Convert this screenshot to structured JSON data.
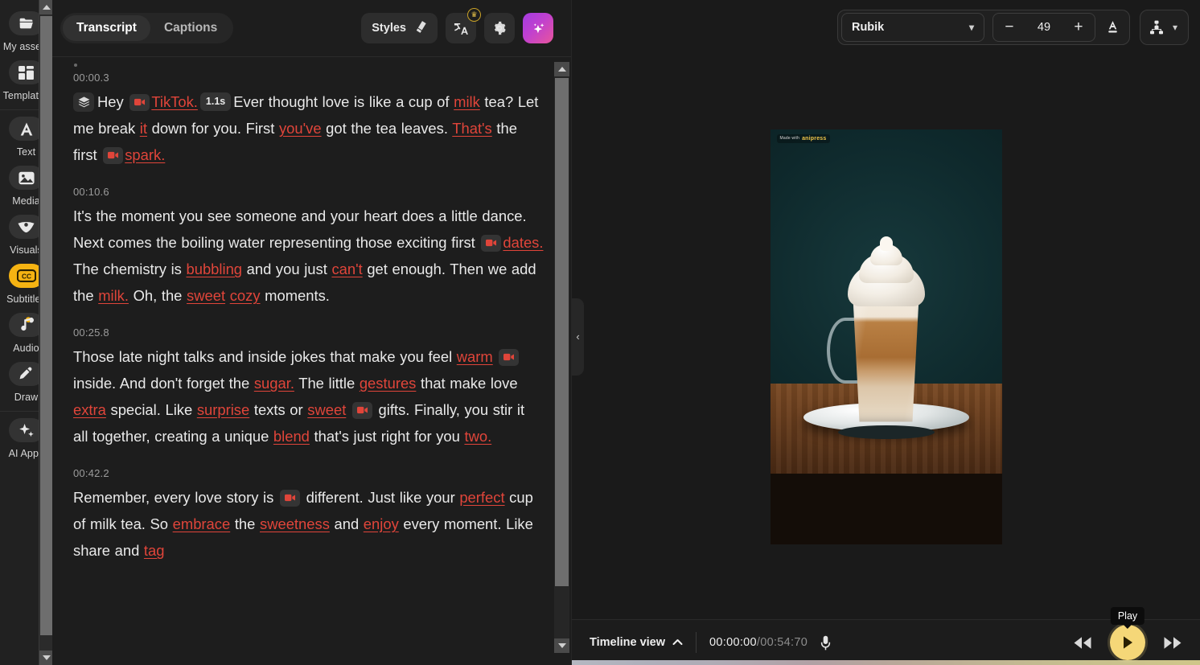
{
  "sidebar": {
    "items": [
      {
        "label": "My assets",
        "icon": "folder-icon",
        "active": false
      },
      {
        "label": "Templates",
        "icon": "templates-grid-icon",
        "active": false
      },
      {
        "label": "Text",
        "icon": "text-a-icon",
        "active": false
      },
      {
        "label": "Media",
        "icon": "media-image-icon",
        "active": false
      },
      {
        "label": "Visuals",
        "icon": "visuals-shape-icon",
        "active": false
      },
      {
        "label": "Subtitles",
        "icon": "closed-caption-icon",
        "active": true
      },
      {
        "label": "Audio",
        "icon": "audio-note-icon",
        "active": false
      },
      {
        "label": "Draw",
        "icon": "draw-pen-icon",
        "active": false
      },
      {
        "label": "AI Apps",
        "icon": "ai-sparkle-icon",
        "active": false
      }
    ],
    "accent_color": "#f5b312"
  },
  "panel": {
    "tabs": [
      {
        "label": "Transcript",
        "active": true
      },
      {
        "label": "Captions",
        "active": false
      }
    ],
    "styles_button": "Styles",
    "translate_icon": "translate-icon",
    "translate_badge": "♛",
    "settings_icon": "gear-icon",
    "ai_icon": "sparkles-icon",
    "ai_gradient": "#c040cf"
  },
  "transcript": {
    "paragraphs": [
      {
        "timestamp": "00:00.3",
        "segments": [
          {
            "type": "layers-chip",
            "text": ""
          },
          {
            "type": "plain",
            "text": "Hey "
          },
          {
            "type": "cam-chip",
            "text": ""
          },
          {
            "type": "keyword",
            "text": "TikTok."
          },
          {
            "type": "pause-chip",
            "text": "1.1s"
          },
          {
            "type": "plain",
            "text": "Ever thought love is like a cup of "
          },
          {
            "type": "keyword",
            "text": "milk"
          },
          {
            "type": "plain",
            "text": " tea? Let me break "
          },
          {
            "type": "keyword",
            "text": "it"
          },
          {
            "type": "plain",
            "text": " down for you. First "
          },
          {
            "type": "keyword",
            "text": "you've"
          },
          {
            "type": "plain",
            "text": " got the tea leaves. "
          },
          {
            "type": "keyword",
            "text": "That's"
          },
          {
            "type": "plain",
            "text": " the first "
          },
          {
            "type": "cam-chip",
            "text": ""
          },
          {
            "type": "keyword",
            "text": "spark."
          }
        ]
      },
      {
        "timestamp": "00:10.6",
        "segments": [
          {
            "type": "plain",
            "text": "It's the moment you see someone and your heart does a little dance. Next comes the boiling water representing those exciting first "
          },
          {
            "type": "cam-chip",
            "text": ""
          },
          {
            "type": "keyword",
            "text": "dates."
          },
          {
            "type": "plain",
            "text": " The chemistry is "
          },
          {
            "type": "keyword",
            "text": "bubbling"
          },
          {
            "type": "plain",
            "text": " and you just "
          },
          {
            "type": "keyword",
            "text": "can't"
          },
          {
            "type": "plain",
            "text": " get enough. Then we add the "
          },
          {
            "type": "keyword",
            "text": "milk."
          },
          {
            "type": "plain",
            "text": " Oh, the "
          },
          {
            "type": "keyword",
            "text": "sweet"
          },
          {
            "type": "plain",
            "text": " "
          },
          {
            "type": "keyword",
            "text": "cozy"
          },
          {
            "type": "plain",
            "text": " moments."
          }
        ]
      },
      {
        "timestamp": "00:25.8",
        "segments": [
          {
            "type": "plain",
            "text": "Those late night talks and inside jokes that make you feel "
          },
          {
            "type": "keyword",
            "text": "warm"
          },
          {
            "type": "plain",
            "text": " "
          },
          {
            "type": "cam-chip",
            "text": ""
          },
          {
            "type": "plain",
            "text": " inside. And don't forget the "
          },
          {
            "type": "keyword",
            "text": "sugar."
          },
          {
            "type": "plain",
            "text": " The little "
          },
          {
            "type": "keyword",
            "text": "gestures"
          },
          {
            "type": "plain",
            "text": " that make love "
          },
          {
            "type": "keyword",
            "text": "extra"
          },
          {
            "type": "plain",
            "text": " special. Like "
          },
          {
            "type": "keyword",
            "text": "surprise"
          },
          {
            "type": "plain",
            "text": " texts or "
          },
          {
            "type": "keyword",
            "text": "sweet"
          },
          {
            "type": "plain",
            "text": " "
          },
          {
            "type": "cam-chip",
            "text": ""
          },
          {
            "type": "plain",
            "text": " gifts. Finally, you stir it all together, creating a unique "
          },
          {
            "type": "keyword",
            "text": "blend"
          },
          {
            "type": "plain",
            "text": " that's just right for you "
          },
          {
            "type": "keyword",
            "text": "two."
          }
        ]
      },
      {
        "timestamp": "00:42.2",
        "segments": [
          {
            "type": "plain",
            "text": "Remember, every love story is "
          },
          {
            "type": "cam-chip",
            "text": ""
          },
          {
            "type": "plain",
            "text": " different. Just like your "
          },
          {
            "type": "keyword",
            "text": "perfect"
          },
          {
            "type": "plain",
            "text": " cup of milk tea. So "
          },
          {
            "type": "keyword",
            "text": "embrace"
          },
          {
            "type": "plain",
            "text": " the "
          },
          {
            "type": "keyword",
            "text": "sweetness"
          },
          {
            "type": "plain",
            "text": " and "
          },
          {
            "type": "keyword",
            "text": "enjoy"
          },
          {
            "type": "plain",
            "text": " every moment. Like share and "
          },
          {
            "type": "keyword",
            "text": "tag"
          }
        ]
      }
    ],
    "keyword_color": "#e0453a"
  },
  "stage_toolbar": {
    "font_family": "Rubik",
    "font_size": "49",
    "decrease_label": "−",
    "increase_label": "+",
    "text_color_icon": "text-color-a-icon",
    "align_icon": "align-distribute-icon",
    "dropdown_icon": "chevron-down-icon"
  },
  "preview": {
    "watermark_prefix": "Made with",
    "watermark_brand": "anipress",
    "collapse_icon": "chevron-left-icon",
    "scene": "milk-tea-glass-with-whipped-cream"
  },
  "bottom_bar": {
    "timeline_view_label": "Timeline view",
    "timeline_chevron": "chevron-up-icon",
    "current_time": "00:00:00",
    "separator": "/",
    "total_time": "00:54:70",
    "mic_icon": "microphone-icon",
    "rewind_icon": "rewind-icon",
    "play_icon": "play-icon",
    "forward_icon": "fast-forward-icon",
    "play_tooltip": "Play",
    "play_color": "#f5d778"
  }
}
